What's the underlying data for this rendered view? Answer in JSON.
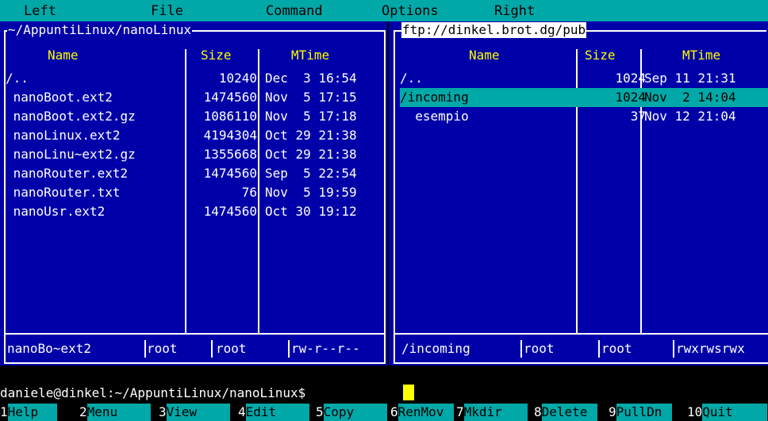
{
  "menubar": {
    "items": [
      "Left",
      "File",
      "Command",
      "Options",
      "Right"
    ]
  },
  "left_panel": {
    "path": "~/AppuntiLinux/nanoLinux",
    "headers": {
      "name": "Name",
      "size": "Size",
      "mtime": "MTime"
    },
    "rows": [
      {
        "name": "/..",
        "size": "10240",
        "mtime": "Dec  3 16:54"
      },
      {
        "name": " nanoBoot.ext2",
        "size": "1474560",
        "mtime": "Nov  5 17:15"
      },
      {
        "name": " nanoBoot.ext2.gz",
        "size": "1086110",
        "mtime": "Nov  5 17:18"
      },
      {
        "name": " nanoLinux.ext2",
        "size": "4194304",
        "mtime": "Oct 29 21:38"
      },
      {
        "name": " nanoLinu~ext2.gz",
        "size": "1355668",
        "mtime": "Oct 29 21:38"
      },
      {
        "name": " nanoRouter.ext2",
        "size": "1474560",
        "mtime": "Sep  5 22:54"
      },
      {
        "name": " nanoRouter.txt",
        "size": "76",
        "mtime": "Nov  5 19:59"
      },
      {
        "name": " nanoUsr.ext2",
        "size": "1474560",
        "mtime": "Oct 30 19:12"
      }
    ],
    "footer": {
      "name": " nanoBo~ext2",
      "owner": "root",
      "group": "root",
      "perm": "rw-r--r--"
    }
  },
  "right_panel": {
    "path": "ftp://dinkel.brot.dg/pub",
    "headers": {
      "name": "Name",
      "size": "Size",
      "mtime": "MTime"
    },
    "rows": [
      {
        "name": "/..",
        "size": "1024",
        "mtime": "Sep 11 21:31"
      },
      {
        "name": "/incoming",
        "size": "1024",
        "mtime": "Nov  2 14:04"
      },
      {
        "name": "  esempio",
        "size": "37",
        "mtime": "Nov 12 21:04"
      }
    ],
    "footer": {
      "name": "/incoming",
      "owner": "root",
      "group": "root",
      "perm": "rwxrwsrwx"
    }
  },
  "command_line": {
    "prompt": "daniele@dinkel:~/AppuntiLinux/nanoLinux$"
  },
  "keybar": [
    {
      "num": "1",
      "label": "Help"
    },
    {
      "num": "2",
      "label": "Menu"
    },
    {
      "num": "3",
      "label": "View"
    },
    {
      "num": "4",
      "label": "Edit"
    },
    {
      "num": "5",
      "label": "Copy"
    },
    {
      "num": "6",
      "label": "RenMov"
    },
    {
      "num": "7",
      "label": "Mkdir"
    },
    {
      "num": "8",
      "label": "Delete"
    },
    {
      "num": "9",
      "label": "PullDn"
    },
    {
      "num": "10",
      "label": "Quit"
    }
  ],
  "colors": {
    "panel_bg": "#0000a8",
    "cyan": "#00a8a8",
    "header_yellow": "#ffff00"
  }
}
